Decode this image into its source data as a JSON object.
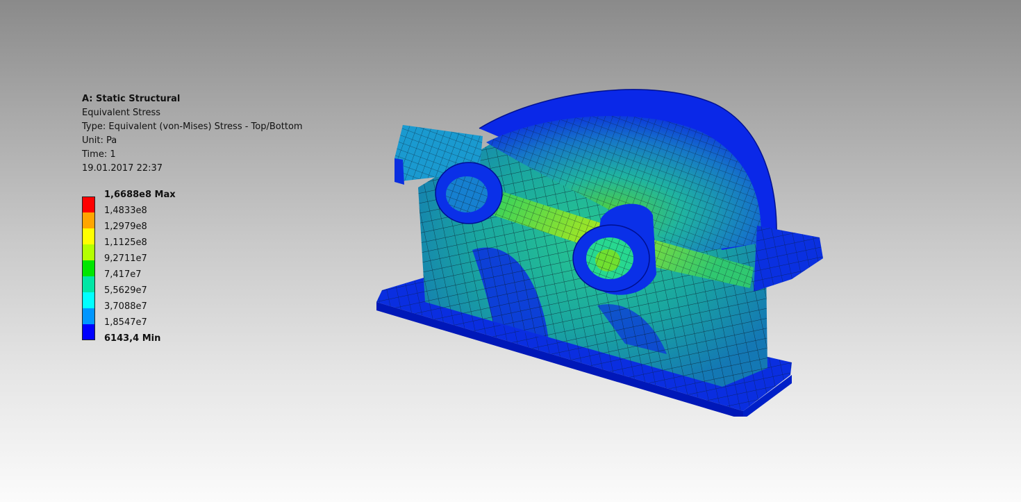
{
  "analysis": {
    "system": "A: Static Structural",
    "result": "Equivalent Stress",
    "type": "Type: Equivalent (von-Mises) Stress - Top/Bottom",
    "unit": "Unit: Pa",
    "time": "Time: 1",
    "timestamp": "19.01.2017 22:37"
  },
  "legend": {
    "labels": [
      {
        "text": "1,6688e8 Max",
        "bold": true
      },
      {
        "text": "1,4833e8",
        "bold": false
      },
      {
        "text": "1,2979e8",
        "bold": false
      },
      {
        "text": "1,1125e8",
        "bold": false
      },
      {
        "text": "9,2711e7",
        "bold": false
      },
      {
        "text": "7,417e7",
        "bold": false
      },
      {
        "text": "5,5629e7",
        "bold": false
      },
      {
        "text": "3,7088e7",
        "bold": false
      },
      {
        "text": "1,8547e7",
        "bold": false
      },
      {
        "text": "6143,4 Min",
        "bold": true
      }
    ],
    "colors": [
      "#ff0000",
      "#ffa500",
      "#ffff00",
      "#b4ff00",
      "#00e600",
      "#00e6a5",
      "#00ffff",
      "#0096ff",
      "#0000ff"
    ]
  }
}
